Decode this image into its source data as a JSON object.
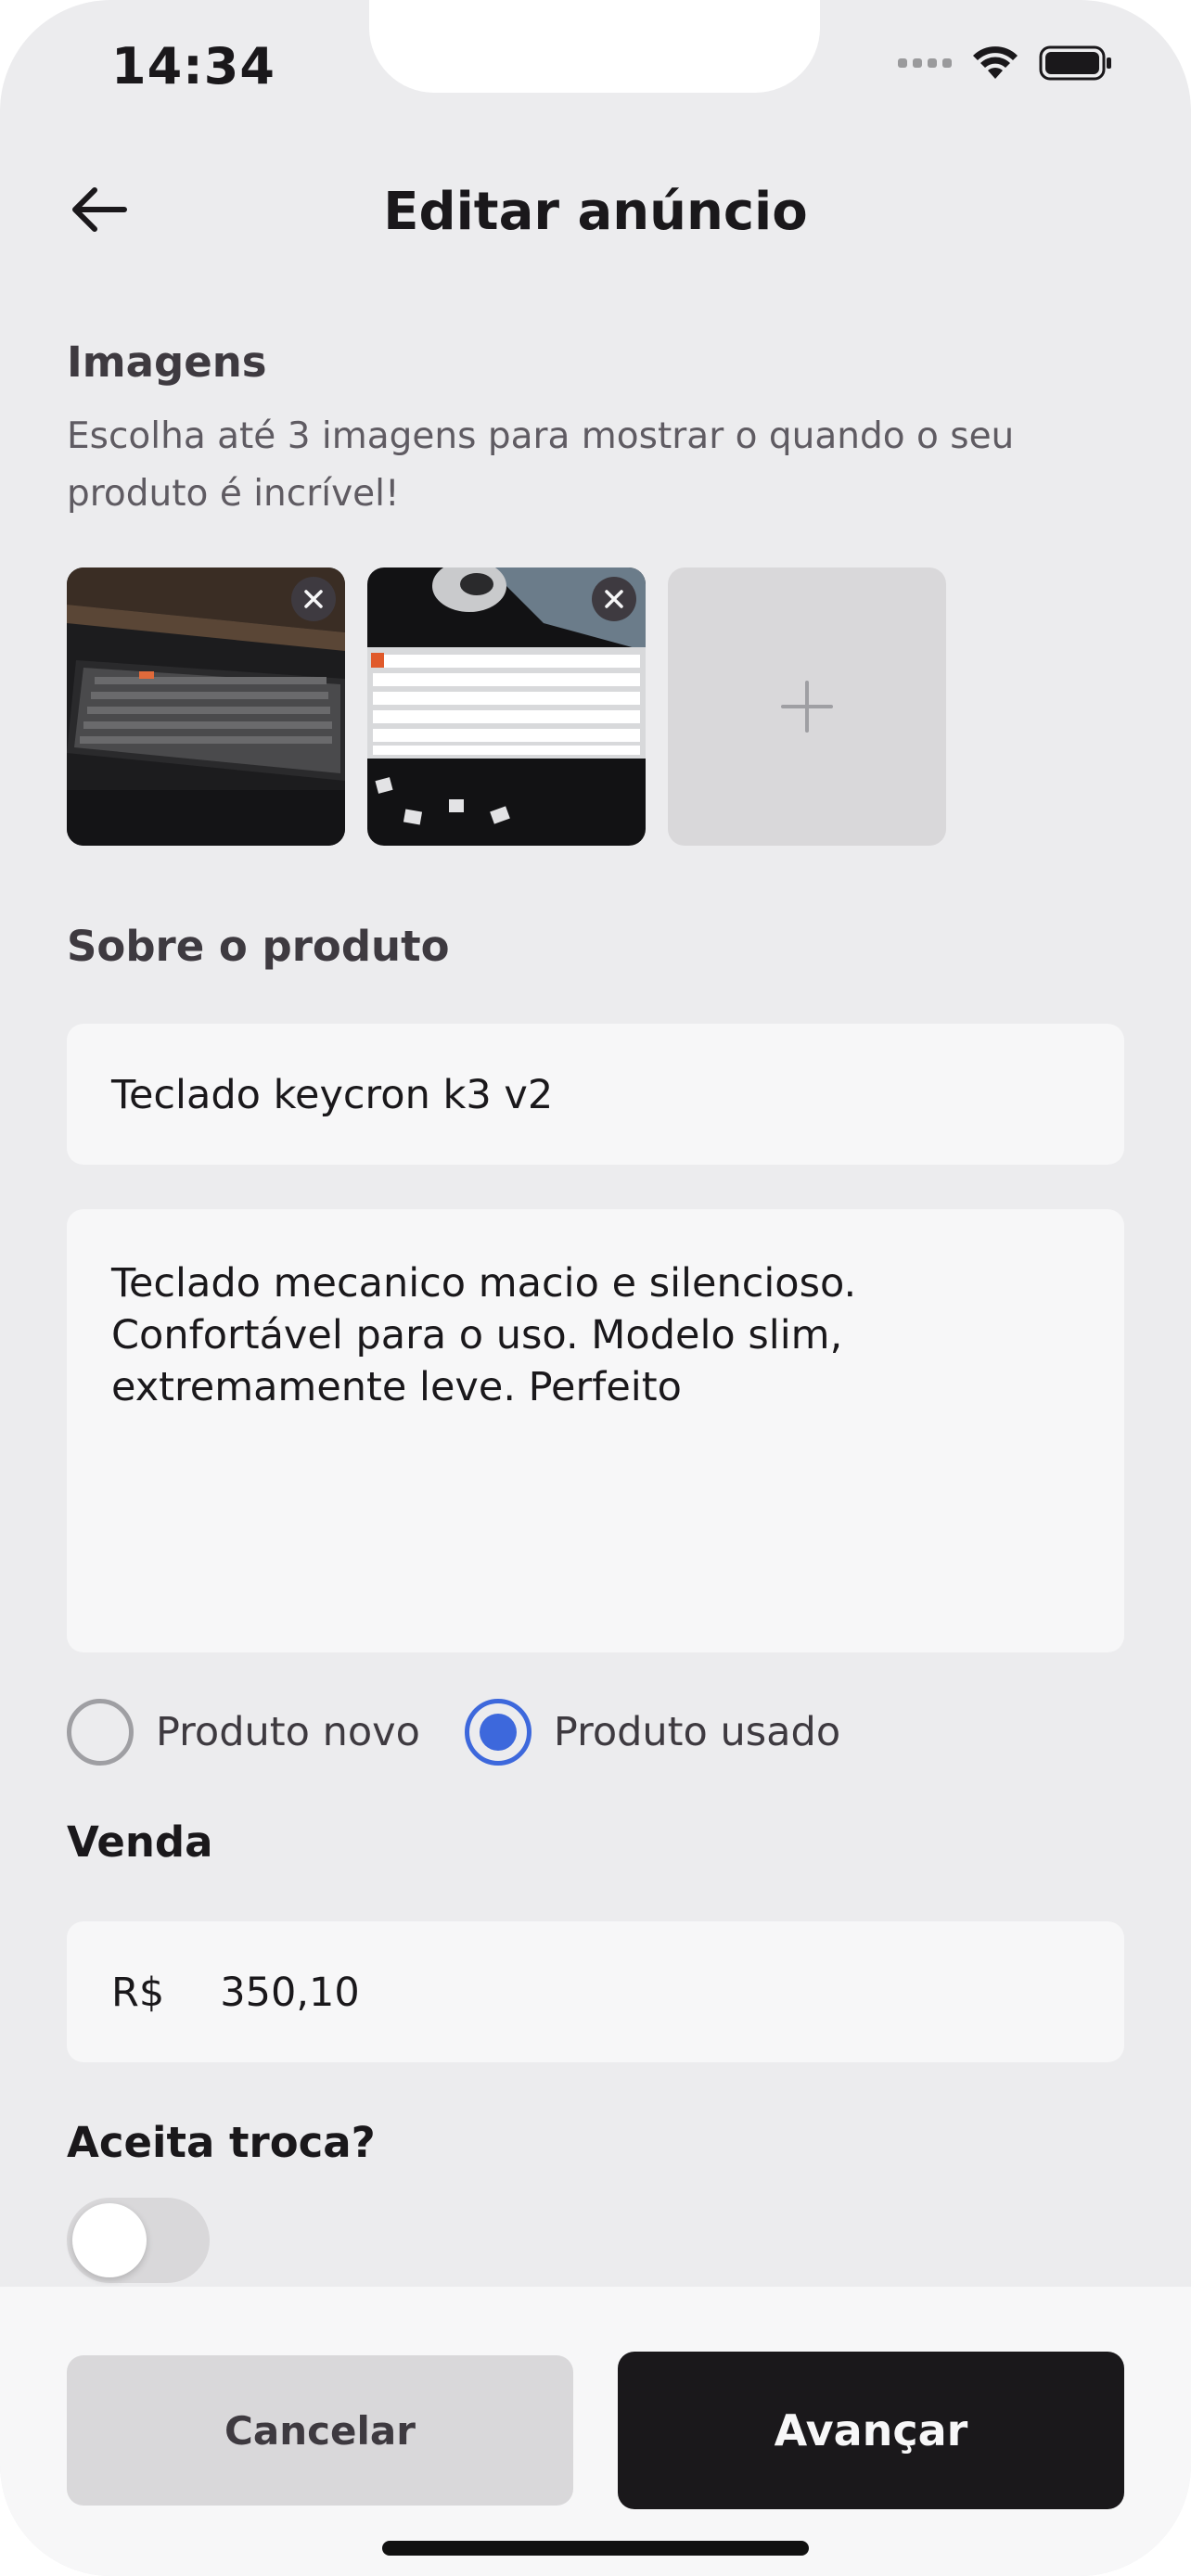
{
  "status_bar": {
    "time": "14:34"
  },
  "header": {
    "title": "Editar anúncio"
  },
  "images_section": {
    "label": "Imagens",
    "helper": "Escolha até 3 imagens para mostrar o quando o seu produto é incrível!"
  },
  "product_section": {
    "label": "Sobre o produto",
    "title_value": "Teclado keycron k3 v2",
    "description_value": "Teclado mecanico macio e silencioso. Confortável para o uso. Modelo slim, extremamente leve. Perfeito",
    "condition_options": [
      "Produto novo",
      "Produto usado"
    ],
    "condition_selected": "Produto usado"
  },
  "sale_section": {
    "label": "Venda",
    "currency": "R$",
    "price_value": "350,10"
  },
  "trade_section": {
    "label": "Aceita troca?",
    "accepts_trade": false
  },
  "footer": {
    "cancel_label": "Cancelar",
    "advance_label": "Avançar"
  },
  "colors": {
    "background": "#ececee",
    "primary_dark": "#1a181b",
    "accent_blue": "#3d68dc",
    "input_bg": "#f7f7f8",
    "muted_button": "#d9d8da"
  }
}
